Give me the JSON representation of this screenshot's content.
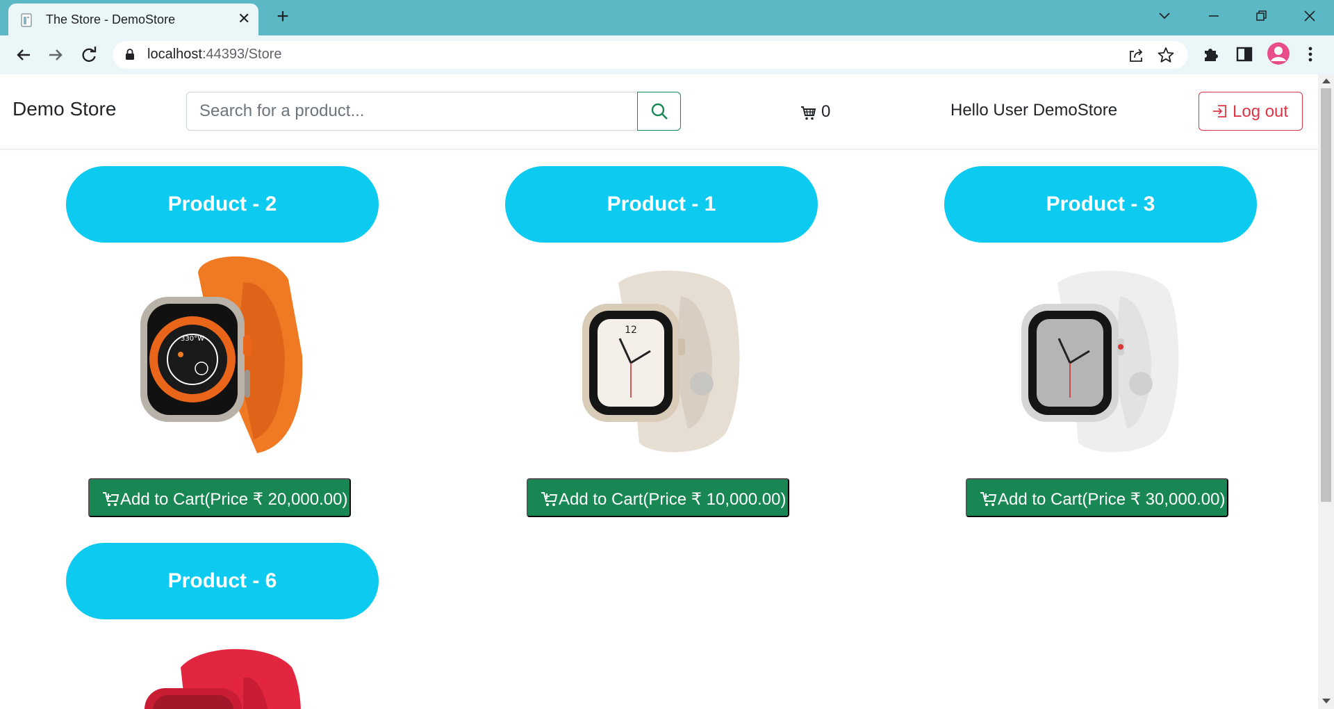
{
  "browser": {
    "tab_title": "The Store - DemoStore",
    "url_host": "localhost",
    "url_rest": ":44393/Store"
  },
  "site": {
    "brand": "Demo Store",
    "search_placeholder": "Search for a product...",
    "cart_count": "0",
    "greeting": "Hello User DemoStore",
    "logout_label": "Log out"
  },
  "products": [
    {
      "title": "Product - 2",
      "button": "Add to Cart(Price ₹ 20,000.00)",
      "watch": "orange-ultra"
    },
    {
      "title": "Product - 1",
      "button": "Add to Cart(Price ₹ 10,000.00)",
      "watch": "starlight"
    },
    {
      "title": "Product - 3",
      "button": "Add to Cart(Price ₹ 30,000.00)",
      "watch": "silver"
    },
    {
      "title": "Product - 6",
      "button": "",
      "watch": "red"
    }
  ],
  "colors": {
    "accent_cyan": "#0dcaf0",
    "success_green": "#198754",
    "danger_red": "#dc3545",
    "chrome_teal": "#5db8c6"
  }
}
